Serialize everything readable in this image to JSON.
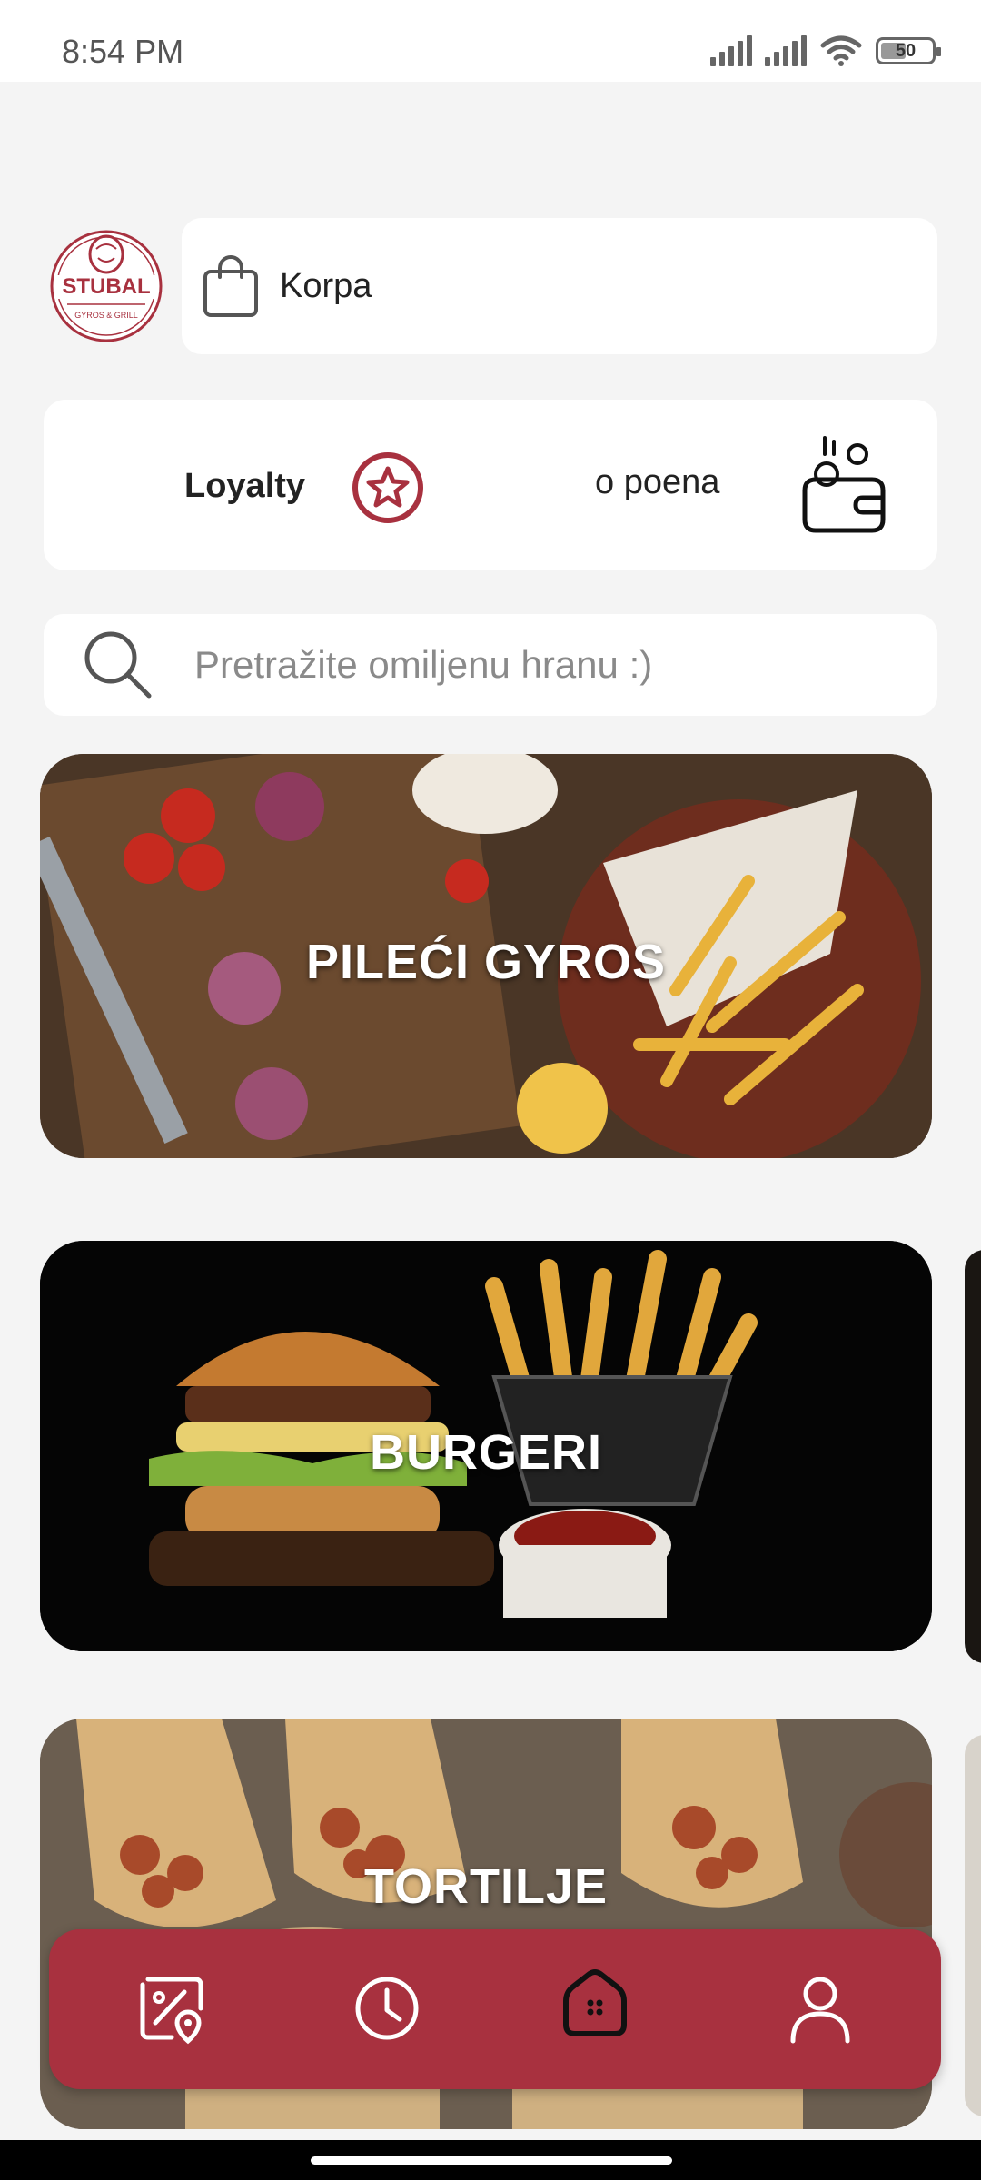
{
  "status_bar": {
    "time": "8:54 PM",
    "battery": "50",
    "battery_level": 0.5
  },
  "header": {
    "logo_text": "STUBAL",
    "logo_subtitle": "GYROS & GRILL",
    "cart_label": "Korpa"
  },
  "loyalty": {
    "title": "Loyalty",
    "points_text": "o poena"
  },
  "search": {
    "placeholder": "Pretražite omiljenu hranu :)",
    "value": ""
  },
  "categories": [
    {
      "title": "PILEĆI GYROS"
    },
    {
      "title": "BURGERI"
    },
    {
      "title": "TORTILJE"
    }
  ],
  "colors": {
    "brand": "#a8313f",
    "background": "#f4f4f4",
    "card": "#ffffff"
  },
  "bottom_nav": {
    "items": [
      {
        "icon": "discount-location-icon"
      },
      {
        "icon": "clock-icon"
      },
      {
        "icon": "home-icon",
        "active": true
      },
      {
        "icon": "profile-icon"
      }
    ]
  }
}
